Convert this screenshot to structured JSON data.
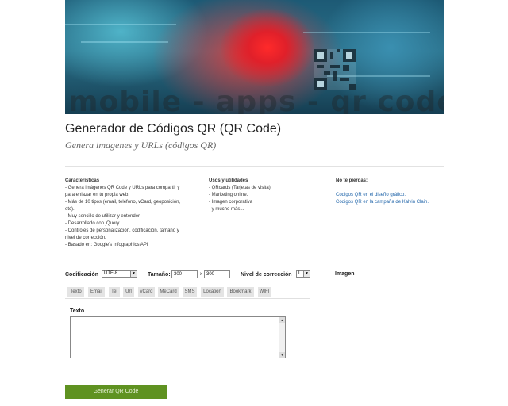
{
  "banner": {
    "text": "mobile - apps - qr code"
  },
  "header": {
    "title": "Generador de Códigos QR (QR Code)",
    "subtitle": "Genera imagenes y URLs (códigos QR)"
  },
  "features": {
    "heading": "Características",
    "lines": [
      "- Genera imágenes QR Code y URLs para compartir y para enlazar en tu propia web.",
      "- Más de 10 tipos (email, teléfono, vCard, geoposición, etc).",
      "- Muy sencillo de utilizar y entender.",
      "- Desarrollado con jQuery.",
      "- Controles de personalización, codificación, tamaño y nivel de corrección.",
      "- Basado en: Google's Infographics API"
    ]
  },
  "uses": {
    "heading": "Usos y utilidades",
    "lines": [
      "- QRcards (Tarjetas de visita).",
      "- Marketing online.",
      "- Imagen corporativa",
      "- y mucho más..."
    ]
  },
  "dont_miss": {
    "heading": "No te pierdas:",
    "links": [
      "Códigos QR en el diseño gráfico.",
      "Códigos QR en la campaña de Kalvin Clain."
    ]
  },
  "controls": {
    "codificacion_label": "Codificación",
    "codificacion_value": "UTF-8",
    "tamano_label": "Tamaño:",
    "width_value": "300",
    "x_label": "x",
    "height_value": "300",
    "nivel_label": "Nivel de corrección",
    "nivel_value": "L"
  },
  "tabs": [
    "Texto",
    "Email",
    "Tel",
    "Url",
    "vCard",
    "MeCard",
    "SMS",
    "Location",
    "Bookmark",
    "WIFI"
  ],
  "form": {
    "texto_label": "Texto",
    "texto_value": ""
  },
  "imagen_label": "Imagen",
  "generate_button": "Generar QR Code"
}
